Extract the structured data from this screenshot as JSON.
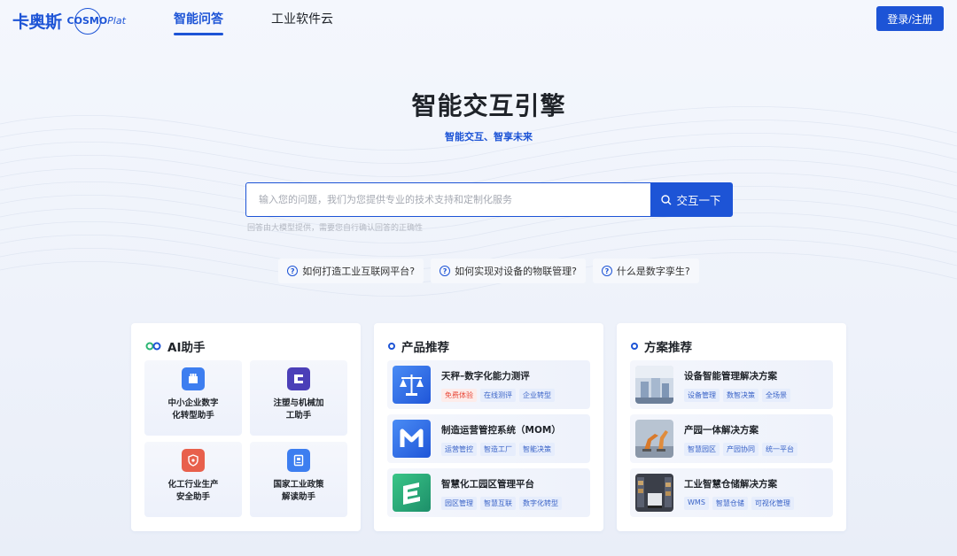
{
  "header": {
    "logo_cn": "卡奥斯",
    "logo_en": "COSMO",
    "logo_en_suffix": "Plat",
    "tabs": [
      {
        "label": "智能问答",
        "active": true
      },
      {
        "label": "工业软件云",
        "active": false
      }
    ],
    "login_label": "登录/注册"
  },
  "hero": {
    "title": "智能交互引擎",
    "subtitle": "智能交互、智享未来",
    "search_placeholder": "输入您的问题，我们为您提供专业的技术支持和定制化服务",
    "search_button": "交互一下",
    "hint": "回答由大模型提供，需要您自行确认回答的正确性"
  },
  "suggestions": [
    "如何打造工业互联网平台?",
    "如何实现对设备的物联管理?",
    "什么是数字孪生?"
  ],
  "ai_card": {
    "title": "AI助手",
    "items": [
      {
        "label": "中小企业数字\n化转型助手",
        "icon": "building-icon",
        "color": "#3d7ef0"
      },
      {
        "label": "注塑与机械加\n工助手",
        "icon": "machine-icon",
        "color": "#4b3fb8"
      },
      {
        "label": "化工行业生产\n安全助手",
        "icon": "shield-icon",
        "color": "#e8604c"
      },
      {
        "label": "国家工业政策\n解读助手",
        "icon": "document-icon",
        "color": "#3d7ef0"
      }
    ]
  },
  "product_card": {
    "title": "产品推荐",
    "items": [
      {
        "title": "天秤–数字化能力测评",
        "icon": "scale-icon",
        "tags": [
          {
            "text": "免费体验",
            "highlight": true
          },
          {
            "text": "在线测评",
            "highlight": false
          },
          {
            "text": "企业转型",
            "highlight": false
          }
        ]
      },
      {
        "title": "制造运营管控系统（MOM）",
        "icon": "m-logo-icon",
        "tags": [
          {
            "text": "运营管控",
            "highlight": false
          },
          {
            "text": "智造工厂",
            "highlight": false
          },
          {
            "text": "智能决策",
            "highlight": false
          }
        ]
      },
      {
        "title": "智慧化工园区管理平台",
        "icon": "e-logo-icon",
        "tags": [
          {
            "text": "园区管理",
            "highlight": false
          },
          {
            "text": "智慧互联",
            "highlight": false
          },
          {
            "text": "数字化转型",
            "highlight": false
          }
        ]
      }
    ]
  },
  "solution_card": {
    "title": "方案推荐",
    "items": [
      {
        "title": "设备智能管理解决方案",
        "icon": "factory-photo",
        "tags": [
          "设备管理",
          "数智决策",
          "全场景"
        ]
      },
      {
        "title": "产园一体解决方案",
        "icon": "robot-arm-photo",
        "tags": [
          "智慧园区",
          "产园协同",
          "统一平台"
        ]
      },
      {
        "title": "工业智慧仓储解决方案",
        "icon": "warehouse-photo",
        "tags": [
          "WMS",
          "智慧仓储",
          "可视化管理"
        ]
      }
    ]
  },
  "colors": {
    "brand": "#1d54d6",
    "tag_bg": "#e6edfc",
    "tag_red": "#e8493a"
  }
}
